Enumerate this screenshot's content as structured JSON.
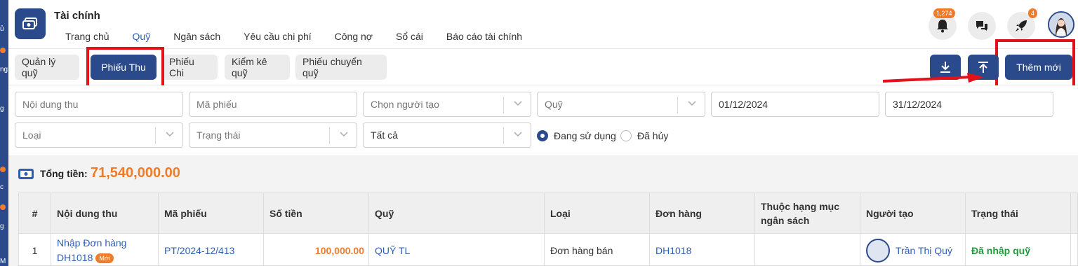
{
  "sidebar_strip": {
    "fragments": [
      "ủ",
      "ng",
      "g",
      "c",
      "g",
      "M"
    ]
  },
  "header": {
    "app_title": "Tài chính",
    "nav": [
      {
        "label": "Trang chủ",
        "active": false
      },
      {
        "label": "Quỹ",
        "active": true
      },
      {
        "label": "Ngân sách",
        "active": false
      },
      {
        "label": "Yêu cầu chi phí",
        "active": false
      },
      {
        "label": "Công nợ",
        "active": false
      },
      {
        "label": "Sổ cái",
        "active": false
      },
      {
        "label": "Báo cáo tài chính",
        "active": false
      }
    ],
    "notifications_badge": "1,274",
    "rocket_badge": "4"
  },
  "tabs": [
    {
      "label": "Quản lý quỹ",
      "active": false
    },
    {
      "label": "Phiếu Thu",
      "active": true
    },
    {
      "label": "Phiếu Chi",
      "active": false
    },
    {
      "label": "Kiểm kê quỹ",
      "active": false
    },
    {
      "label": "Phiếu chuyển quỹ",
      "active": false
    }
  ],
  "actions": {
    "download_icon": "download-icon",
    "upload_icon": "upload-icon",
    "add_label": "Thêm mới"
  },
  "filters": {
    "content_placeholder": "Nội dung thu",
    "code_placeholder": "Mã phiếu",
    "creator_placeholder": "Chọn người tạo",
    "fund_placeholder": "Quỹ",
    "date_from": "01/12/2024",
    "date_to": "31/12/2024",
    "type_placeholder": "Loại",
    "status_placeholder": "Trạng thái",
    "all_value": "Tất cả",
    "radio_active": "Đang sử dụng",
    "radio_cancelled": "Đã hủy"
  },
  "summary": {
    "label": "Tổng tiền:",
    "value": "71,540,000.00"
  },
  "table": {
    "headers": {
      "index": "#",
      "content": "Nội dung thu",
      "code": "Mã phiếu",
      "amount": "Số tiền",
      "fund": "Quỹ",
      "type": "Loại",
      "order": "Đơn hàng",
      "budget_line1": "Thuộc hạng mục",
      "budget_line2": "ngân sách",
      "creator": "Người tạo",
      "status": "Trạng thái"
    },
    "rows": [
      {
        "index": "1",
        "content_line1": "Nhập Đơn hàng",
        "content_line2": "DH1018",
        "new_badge": "Mới",
        "code": "PT/2024-12/413",
        "amount": "100,000.00",
        "fund": "QUỸ TL",
        "type": "Đơn hàng bán",
        "order": "DH1018",
        "creator": "Trần Thị Quý",
        "status": "Đã nhập quỹ"
      }
    ]
  },
  "colors": {
    "primary": "#2b4a8b",
    "accent": "#f07c2a",
    "link": "#2f5fb3",
    "highlight": "#e3111a",
    "success": "#1f9d3a"
  }
}
